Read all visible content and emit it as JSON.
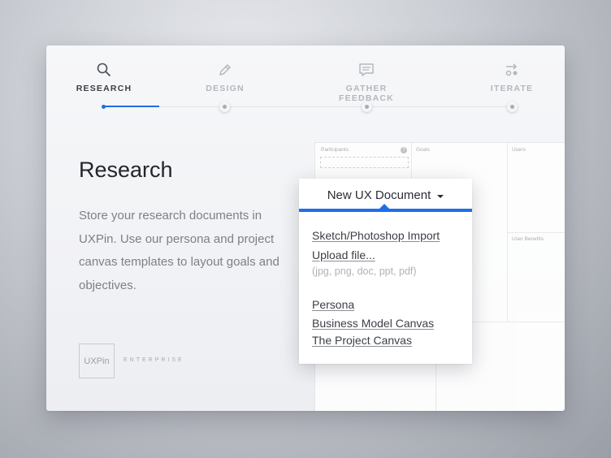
{
  "steps": [
    {
      "label": "RESEARCH",
      "icon": "search-icon",
      "active": true
    },
    {
      "label": "DESIGN",
      "icon": "pencil-icon",
      "active": false
    },
    {
      "label": "GATHER FEEDBACK",
      "icon": "comment-icon",
      "active": false
    },
    {
      "label": "ITERATE",
      "icon": "iterate-icon",
      "active": false
    }
  ],
  "main": {
    "title": "Research",
    "description": "Store your research documents in UXPin. Use our persona and project canvas templates to layout goals and objectives."
  },
  "logo": {
    "name": "UXPin",
    "subtitle": "ENTERPRISE"
  },
  "canvas": {
    "labels": [
      "Participants",
      "Goals",
      "Users",
      "User Benefits"
    ],
    "help": "?"
  },
  "dropdown": {
    "title": "New UX Document",
    "items": [
      "Sketch/Photoshop Import",
      "Upload file..."
    ],
    "hint": "(jpg, png, doc, ppt, pdf)",
    "templates": [
      "Persona",
      "Business Model Canvas",
      "The Project Canvas"
    ]
  },
  "colors": {
    "accent": "#1f6ee8",
    "text": "#23252a",
    "muted": "#7c8088"
  }
}
